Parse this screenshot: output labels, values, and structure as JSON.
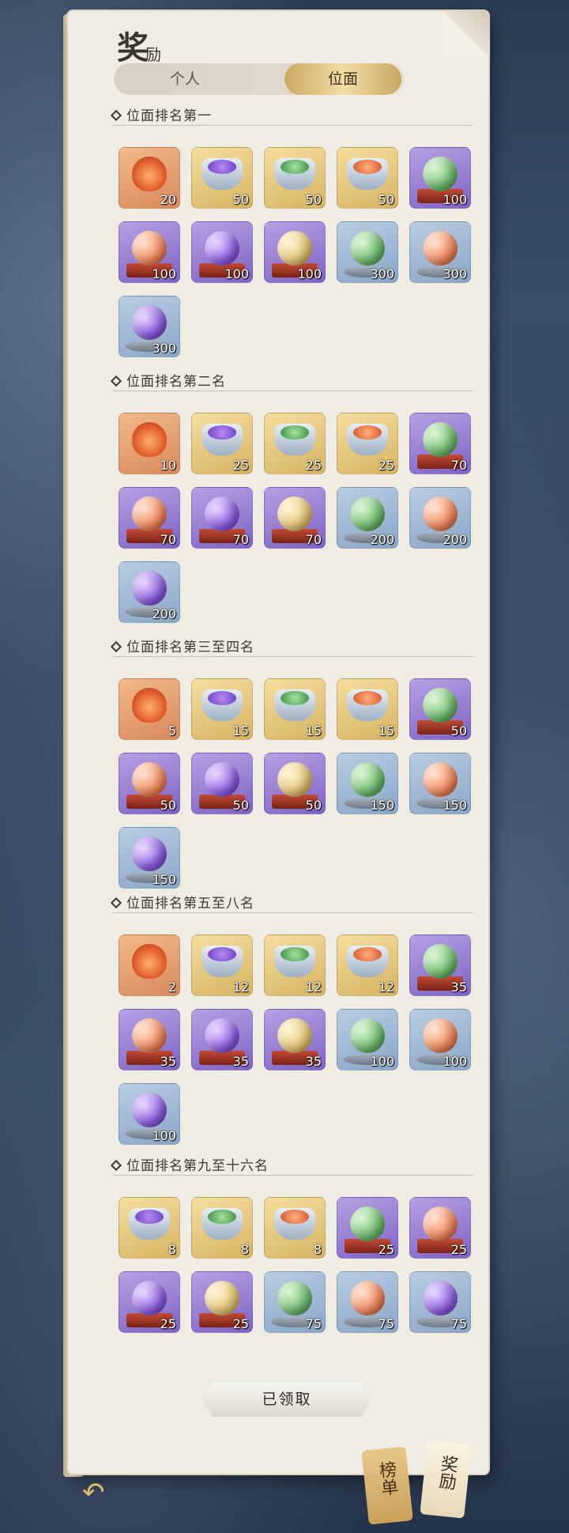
{
  "title": {
    "big": "奖",
    "small": "励"
  },
  "tabs": {
    "personal": "个人",
    "plane": "位面"
  },
  "sections": [
    {
      "title": "位面排名第一",
      "items": [
        {
          "kind": "flower",
          "bg": "orange",
          "qty": "20"
        },
        {
          "kind": "pot",
          "color": "purple",
          "bg": "gold",
          "qty": "50"
        },
        {
          "kind": "pot",
          "color": "green",
          "bg": "gold",
          "qty": "50"
        },
        {
          "kind": "pot",
          "color": "red",
          "bg": "gold",
          "qty": "50"
        },
        {
          "kind": "box",
          "color": "green",
          "bg": "purple",
          "qty": "100"
        },
        {
          "kind": "box",
          "color": "red",
          "bg": "purple",
          "qty": "100"
        },
        {
          "kind": "box",
          "color": "purple",
          "bg": "purple",
          "qty": "100"
        },
        {
          "kind": "box",
          "color": "gold",
          "bg": "purple",
          "qty": "100"
        },
        {
          "kind": "stand",
          "color": "green",
          "bg": "blue",
          "qty": "300"
        },
        {
          "kind": "stand",
          "color": "red",
          "bg": "blue",
          "qty": "300"
        },
        {
          "kind": "stand",
          "color": "purple",
          "bg": "blue",
          "qty": "300"
        }
      ]
    },
    {
      "title": "位面排名第二名",
      "items": [
        {
          "kind": "flower",
          "bg": "orange",
          "qty": "10"
        },
        {
          "kind": "pot",
          "color": "purple",
          "bg": "gold",
          "qty": "25"
        },
        {
          "kind": "pot",
          "color": "green",
          "bg": "gold",
          "qty": "25"
        },
        {
          "kind": "pot",
          "color": "red",
          "bg": "gold",
          "qty": "25"
        },
        {
          "kind": "box",
          "color": "green",
          "bg": "purple",
          "qty": "70"
        },
        {
          "kind": "box",
          "color": "red",
          "bg": "purple",
          "qty": "70"
        },
        {
          "kind": "box",
          "color": "purple",
          "bg": "purple",
          "qty": "70"
        },
        {
          "kind": "box",
          "color": "gold",
          "bg": "purple",
          "qty": "70"
        },
        {
          "kind": "stand",
          "color": "green",
          "bg": "blue",
          "qty": "200"
        },
        {
          "kind": "stand",
          "color": "red",
          "bg": "blue",
          "qty": "200"
        },
        {
          "kind": "stand",
          "color": "purple",
          "bg": "blue",
          "qty": "200"
        }
      ]
    },
    {
      "title": "位面排名第三至四名",
      "items": [
        {
          "kind": "flower",
          "bg": "orange",
          "qty": "5"
        },
        {
          "kind": "pot",
          "color": "purple",
          "bg": "gold",
          "qty": "15"
        },
        {
          "kind": "pot",
          "color": "green",
          "bg": "gold",
          "qty": "15"
        },
        {
          "kind": "pot",
          "color": "red",
          "bg": "gold",
          "qty": "15"
        },
        {
          "kind": "box",
          "color": "green",
          "bg": "purple",
          "qty": "50"
        },
        {
          "kind": "box",
          "color": "red",
          "bg": "purple",
          "qty": "50"
        },
        {
          "kind": "box",
          "color": "purple",
          "bg": "purple",
          "qty": "50"
        },
        {
          "kind": "box",
          "color": "gold",
          "bg": "purple",
          "qty": "50"
        },
        {
          "kind": "stand",
          "color": "green",
          "bg": "blue",
          "qty": "150"
        },
        {
          "kind": "stand",
          "color": "red",
          "bg": "blue",
          "qty": "150"
        },
        {
          "kind": "stand",
          "color": "purple",
          "bg": "blue",
          "qty": "150"
        }
      ]
    },
    {
      "title": "位面排名第五至八名",
      "items": [
        {
          "kind": "flower",
          "bg": "orange",
          "qty": "2"
        },
        {
          "kind": "pot",
          "color": "purple",
          "bg": "gold",
          "qty": "12"
        },
        {
          "kind": "pot",
          "color": "green",
          "bg": "gold",
          "qty": "12"
        },
        {
          "kind": "pot",
          "color": "red",
          "bg": "gold",
          "qty": "12"
        },
        {
          "kind": "box",
          "color": "green",
          "bg": "purple",
          "qty": "35"
        },
        {
          "kind": "box",
          "color": "red",
          "bg": "purple",
          "qty": "35"
        },
        {
          "kind": "box",
          "color": "purple",
          "bg": "purple",
          "qty": "35"
        },
        {
          "kind": "box",
          "color": "gold",
          "bg": "purple",
          "qty": "35"
        },
        {
          "kind": "stand",
          "color": "green",
          "bg": "blue",
          "qty": "100"
        },
        {
          "kind": "stand",
          "color": "red",
          "bg": "blue",
          "qty": "100"
        },
        {
          "kind": "stand",
          "color": "purple",
          "bg": "blue",
          "qty": "100"
        }
      ]
    },
    {
      "title": "位面排名第九至十六名",
      "items": [
        {
          "kind": "pot",
          "color": "purple",
          "bg": "gold",
          "qty": "8"
        },
        {
          "kind": "pot",
          "color": "green",
          "bg": "gold",
          "qty": "8"
        },
        {
          "kind": "pot",
          "color": "red",
          "bg": "gold",
          "qty": "8"
        },
        {
          "kind": "box",
          "color": "green",
          "bg": "purple",
          "qty": "25"
        },
        {
          "kind": "box",
          "color": "red",
          "bg": "purple",
          "qty": "25"
        },
        {
          "kind": "box",
          "color": "purple",
          "bg": "purple",
          "qty": "25"
        },
        {
          "kind": "box",
          "color": "gold",
          "bg": "purple",
          "qty": "25"
        },
        {
          "kind": "stand",
          "color": "green",
          "bg": "blue",
          "qty": "75"
        },
        {
          "kind": "stand",
          "color": "red",
          "bg": "blue",
          "qty": "75"
        },
        {
          "kind": "stand",
          "color": "purple",
          "bg": "blue",
          "qty": "75"
        }
      ]
    }
  ],
  "claim_button": "已领取",
  "side_tabs": {
    "rank": "榜单",
    "reward": "奖励"
  },
  "colors": {
    "accent_gold": "#e4c06b",
    "paper": "#efece4"
  }
}
